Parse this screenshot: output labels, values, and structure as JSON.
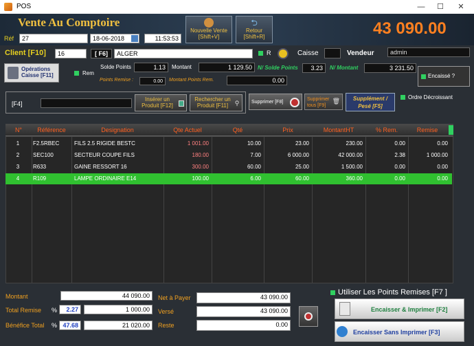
{
  "window": {
    "title": "POS",
    "min": "—",
    "max": "☐",
    "close": "✕"
  },
  "app": {
    "title": "Vente Au Comptoire",
    "total_display": "43 090.00"
  },
  "top": {
    "ref_label": "Réf",
    "ref_value": "27",
    "date": "18-06-2018",
    "time": "11:53:53"
  },
  "buttons": {
    "nouvelle_vente": "Nouvelle Vente",
    "nouvelle_vente_sc": "[Shift+V]",
    "retour": "Retour",
    "retour_sc": "[Shift+R]",
    "operations_caisse": "Opérations Caisse [F11]",
    "encaisse": "Encaissé ?",
    "inserer": "Insérer un Produit [F12]",
    "rechercher": "Rechercher un Produit [F11]",
    "supprimer": "Supprimer [F8]",
    "supprimer_tous": "Supprimer tous [F9]",
    "supplement": "Supplément / Pesé [F5]",
    "encaisser_imprimer": "Encaisser & Imprimer [F2]",
    "encaisser_sans": "Encaisser Sans Imprimer [F3]"
  },
  "client": {
    "label": "Client [F10]",
    "code": "16",
    "f6": "[ F6]",
    "name": "ALGER",
    "r_label": "R",
    "caisse_label": "Caisse",
    "caisse_value": "",
    "vendeur_label": "Vendeur",
    "vendeur_value": "admin"
  },
  "points": {
    "rem_label": "Rem",
    "solde_label": "Solde Points",
    "solde_value": "1.13",
    "montant_label": "Montant",
    "montant_value": "1 129.50",
    "n_solde_label": "N/ Solde Points",
    "n_solde_value": "3.23",
    "n_montant_label": "N/ Montant",
    "n_montant_value": "3 231.50",
    "remise_label": "Points Remise :",
    "remise_value": "0.00",
    "montant_rem_label": "Montant Points Rem.",
    "montant_rem_value": "0.00"
  },
  "search": {
    "f4": "[F4]",
    "value": "",
    "ordre": "Ordre Décroissant"
  },
  "table": {
    "headers": [
      "N°",
      "Référence",
      "Designation",
      "Qte Actuel",
      "Qté",
      "Prix",
      "MontantHT",
      "% Rem.",
      "Remise"
    ],
    "rows": [
      [
        "1",
        "F2.5RBEC",
        "FILS 2.5 RIGIDE BESTC",
        "1 001.00",
        "10.00",
        "23.00",
        "230.00",
        "0.00",
        "0.00"
      ],
      [
        "2",
        "SEC100",
        "SECTEUR COUPE FILS",
        "180.00",
        "7.00",
        "6 000.00",
        "42 000.00",
        "2.38",
        "1 000.00"
      ],
      [
        "3",
        "R633",
        "GAINE RESSORT 16",
        "300.00",
        "60.00",
        "25.00",
        "1 500.00",
        "0.00",
        "0.00"
      ],
      [
        "4",
        "R109",
        "LAMPE ORDINAIRE E14",
        "100.00",
        "6.00",
        "60.00",
        "360.00",
        "0.00",
        "0.00"
      ]
    ]
  },
  "summary": {
    "montant_label": "Montant",
    "montant_value": "44 090.00",
    "total_remise_label": "Total Remise",
    "pct": "%",
    "total_remise_pct": "2.27",
    "total_remise_value": "1 000.00",
    "benefice_label": "Bénéfice Total",
    "benefice_pct": "47.68",
    "benefice_value": "21 020.00",
    "net_label": "Net à Payer",
    "net_value": "43 090.00",
    "verse_label": "Versé",
    "verse_value": "43 090.00",
    "reste_label": "Reste",
    "reste_value": "0.00",
    "utiliser_points": "Utiliser Les Points Remises [F7 ]"
  }
}
